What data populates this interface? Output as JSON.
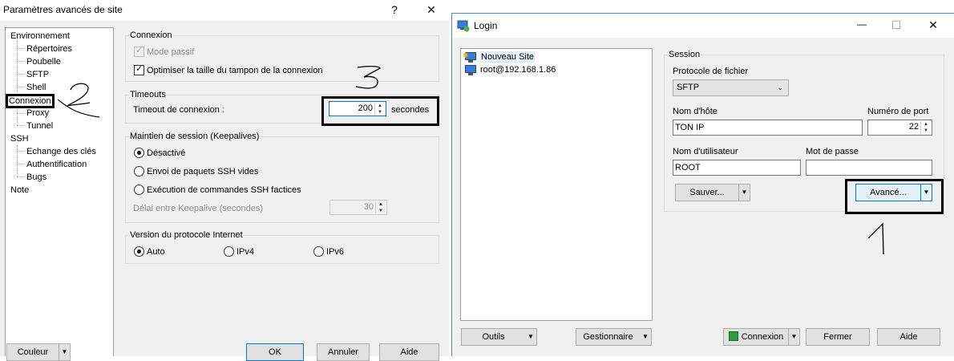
{
  "advanced": {
    "title": "Paramètres avancés de site",
    "help_label": "?",
    "close_label": "✕",
    "tree": {
      "items": [
        {
          "label": "Environnement",
          "level": 0
        },
        {
          "label": "Répertoires",
          "level": 1
        },
        {
          "label": "Poubelle",
          "level": 1
        },
        {
          "label": "SFTP",
          "level": 1
        },
        {
          "label": "Shell",
          "level": 1
        },
        {
          "label": "Connexion",
          "level": 0,
          "selected": true
        },
        {
          "label": "Proxy",
          "level": 1
        },
        {
          "label": "Tunnel",
          "level": 1
        },
        {
          "label": "SSH",
          "level": 0
        },
        {
          "label": "Echange des clés",
          "level": 1
        },
        {
          "label": "Authentification",
          "level": 1
        },
        {
          "label": "Bugs",
          "level": 1
        },
        {
          "label": "Note",
          "level": 0
        }
      ]
    },
    "connexion": {
      "group_label": "Connexion",
      "mode_passif": "Mode passif",
      "mode_passif_checked": true,
      "optimiser": "Optimiser la taille du tampon de la connexion",
      "optimiser_checked": true
    },
    "timeouts": {
      "group_label": "Timeouts",
      "label": "Timeout de connexion :",
      "value": "200",
      "unit": "secondes"
    },
    "keepalive": {
      "group_label": "Maintien de session (Keepalives)",
      "options": [
        "Désactivé",
        "Envoi de paquets SSH vides",
        "Exécution de commandes SSH factices"
      ],
      "selected": "Désactivé",
      "interval_label": "Délai entre Keepalive (secondes)",
      "interval_value": "30"
    },
    "protocol": {
      "group_label": "Version du protocole Internet",
      "options": [
        "Auto",
        "IPv4",
        "IPv6"
      ],
      "selected": "Auto"
    },
    "buttons": {
      "color": "Couleur",
      "ok": "OK",
      "cancel": "Annuler",
      "help": "Aide"
    }
  },
  "login": {
    "title": "Login",
    "minimize": "—",
    "maximize": "☐",
    "close": "✕",
    "sites": [
      {
        "label": "Nouveau Site",
        "selected": true
      },
      {
        "label": "root@192.168.1.86",
        "selected": false
      }
    ],
    "session": {
      "group_label": "Session",
      "protocol_label": "Protocole de fichier",
      "protocol_value": "SFTP",
      "host_label": "Nom d'hôte",
      "host_value": "TON IP",
      "port_label": "Numéro de port",
      "port_value": "22",
      "user_label": "Nom d'utilisateur",
      "user_value": "ROOT",
      "password_label": "Mot de passe",
      "password_value": "",
      "save_button": "Sauver...",
      "advanced_button": "Avancé..."
    },
    "bottom": {
      "tools": "Outils",
      "manager": "Gestionnaire",
      "connect": "Connexion",
      "close": "Fermer",
      "help": "Aide"
    }
  },
  "annotations": [
    "2",
    "3",
    "1"
  ]
}
